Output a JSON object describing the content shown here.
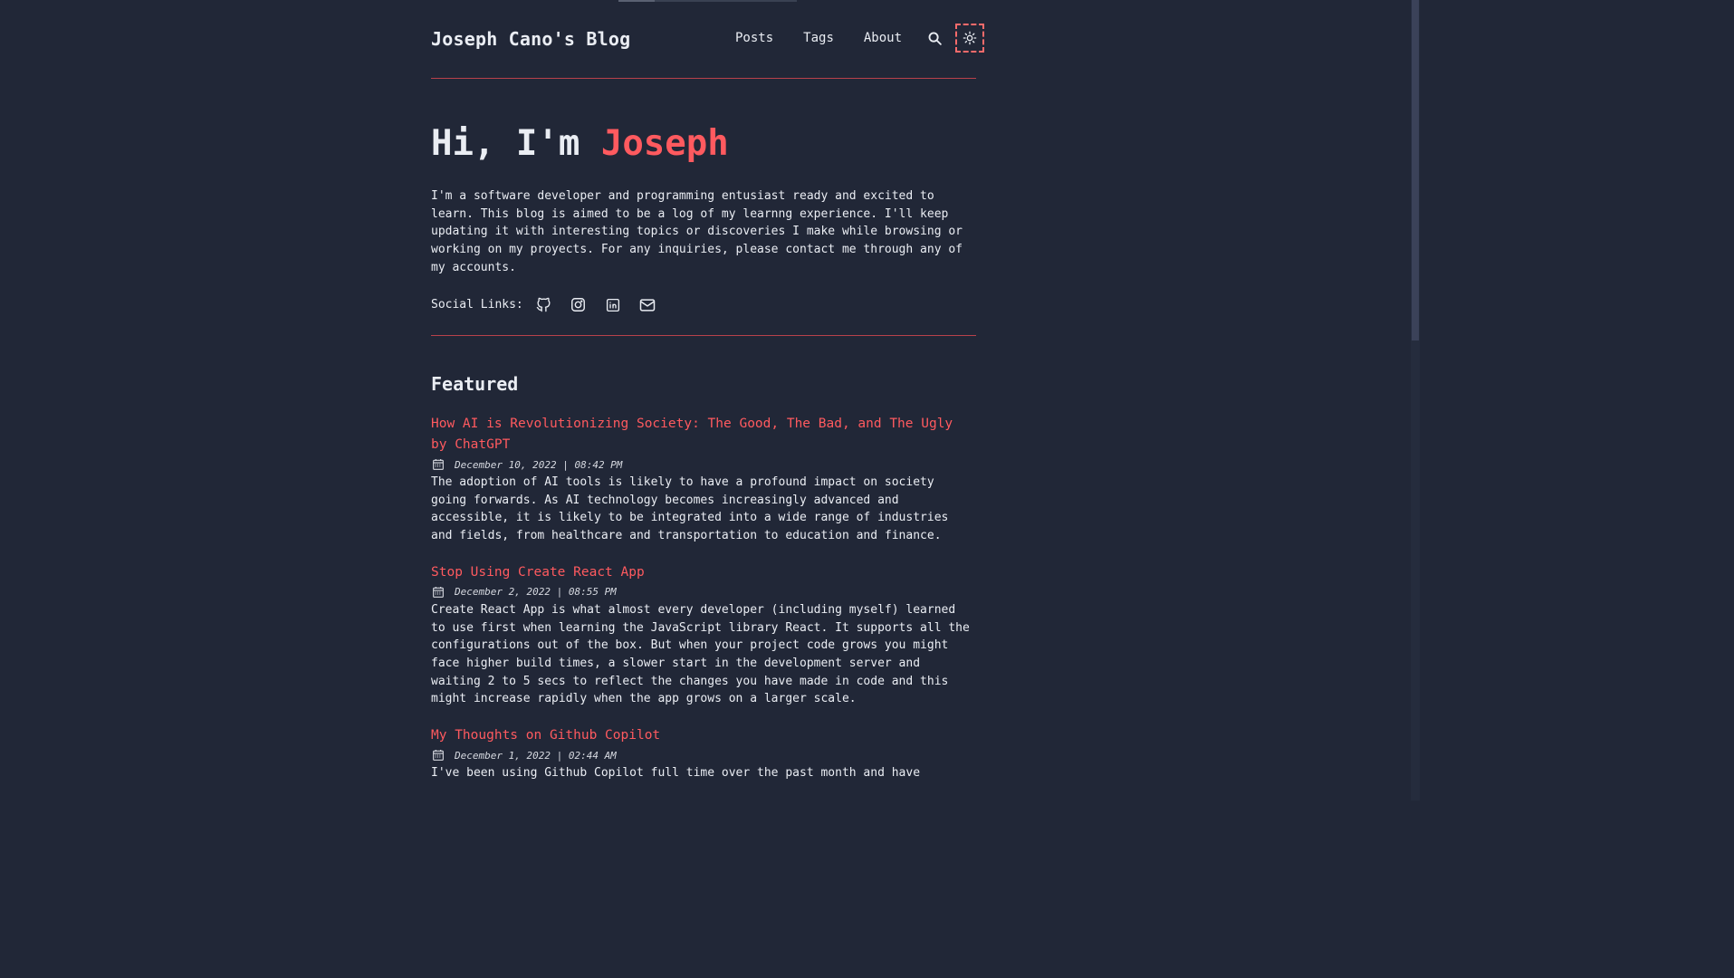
{
  "site": {
    "title": "Joseph Cano's Blog"
  },
  "nav": {
    "items": [
      "Posts",
      "Tags",
      "About"
    ],
    "search_icon": "search-icon",
    "theme_icon": "sun-icon"
  },
  "hero": {
    "greeting": "Hi, I'm ",
    "name": "Joseph",
    "intro": "I'm a software developer and programming entusiast ready and excited to learn. This blog is aimed to be a log of my learnng experience. I'll keep updating it with interesting topics or discoveries I make while browsing or working on my proyects. For any inquiries, please contact me through any of my accounts.",
    "social_label": "Social Links:",
    "social_icons": [
      "github-icon",
      "instagram-icon",
      "linkedin-icon",
      "mail-icon"
    ]
  },
  "featured": {
    "heading": "Featured",
    "posts": [
      {
        "title": "How AI is Revolutionizing Society: The Good, The Bad, and The Ugly by ChatGPT",
        "date": "December 10, 2022 | 08:42 PM",
        "description": "The adoption of AI tools is likely to have a profound impact on society going forwards. As AI technology becomes increasingly advanced and accessible, it is likely to be integrated into a wide range of industries and fields, from healthcare and transportation to education and finance."
      },
      {
        "title": "Stop Using Create React App",
        "date": "December 2, 2022 | 08:55 PM",
        "description": "Create React App is what almost every developer (including myself) learned to use first when learning the JavaScript library React. It supports all the configurations out of the box. But when your project code grows you might face higher build times, a slower start in the development server and waiting 2 to 5 secs to reflect the changes you have made in code and this might increase rapidly when the app grows on a larger scale."
      },
      {
        "title": "My Thoughts on Github Copilot",
        "date": "December 1, 2022 | 02:44 AM",
        "description": "I've been using Github Copilot full time over the past month and have"
      }
    ]
  },
  "colors": {
    "background": "#212737",
    "text": "#eaedf3",
    "accent": "#ff5a5f",
    "divider": "#b8414b"
  }
}
